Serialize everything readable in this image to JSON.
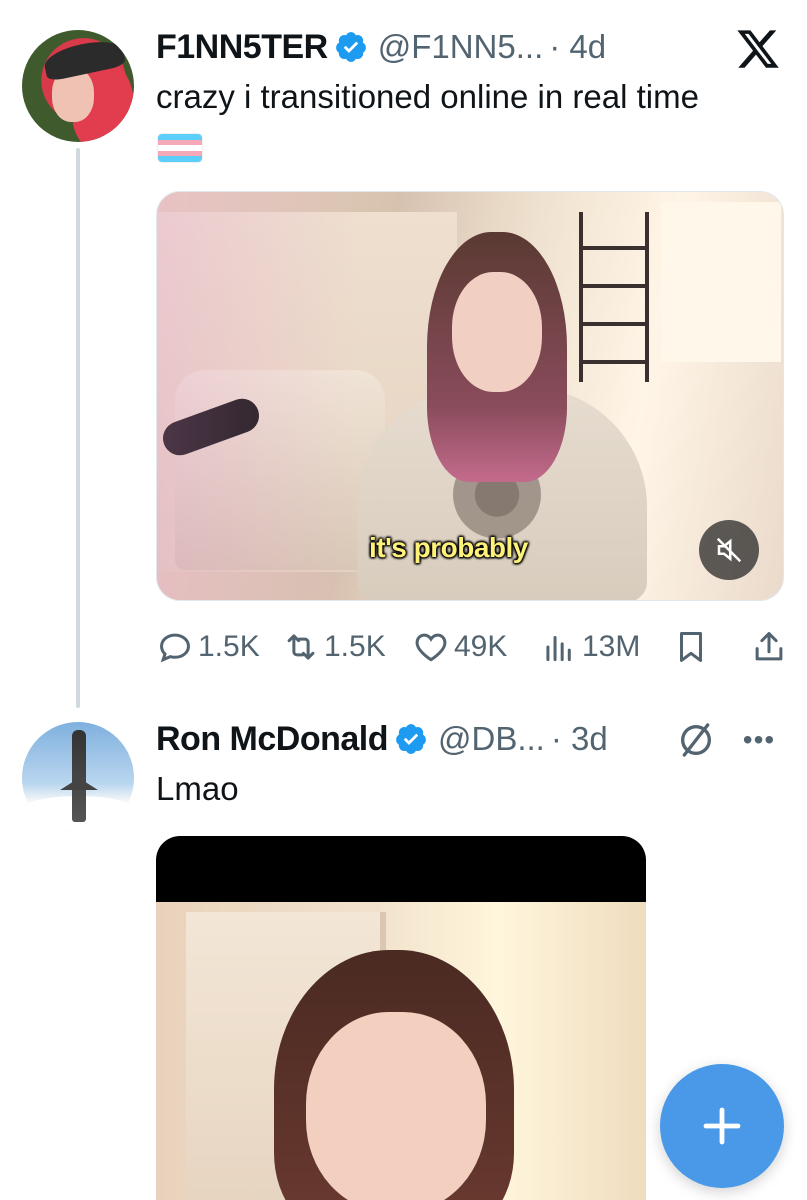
{
  "tweets": [
    {
      "author": {
        "name": "F1NN5TER",
        "handle": "@F1NN5...",
        "time": "· 4d",
        "verified": true
      },
      "text": "crazy i transitioned online in real time",
      "emoji": "transgender-flag",
      "media": {
        "caption": "it's probably",
        "muted": true
      },
      "stats": {
        "replies": "1.5K",
        "reposts": "1.5K",
        "likes": "49K",
        "views": "13M"
      }
    },
    {
      "author": {
        "name": "Ron McDonald",
        "handle": "@DB...",
        "time": "· 3d",
        "verified": true
      },
      "text": "Lmao"
    }
  ],
  "colors": {
    "verified": "#1d9bf0",
    "fab": "#4a99e9",
    "secondary_text": "#536471",
    "thread_line": "#cfd9de"
  },
  "icons": [
    "x-logo-icon",
    "verified-icon",
    "mute-icon",
    "reply-icon",
    "repost-icon",
    "like-icon",
    "views-icon",
    "bookmark-icon",
    "share-icon",
    "grok-icon",
    "more-icon",
    "compose-plus-icon"
  ]
}
